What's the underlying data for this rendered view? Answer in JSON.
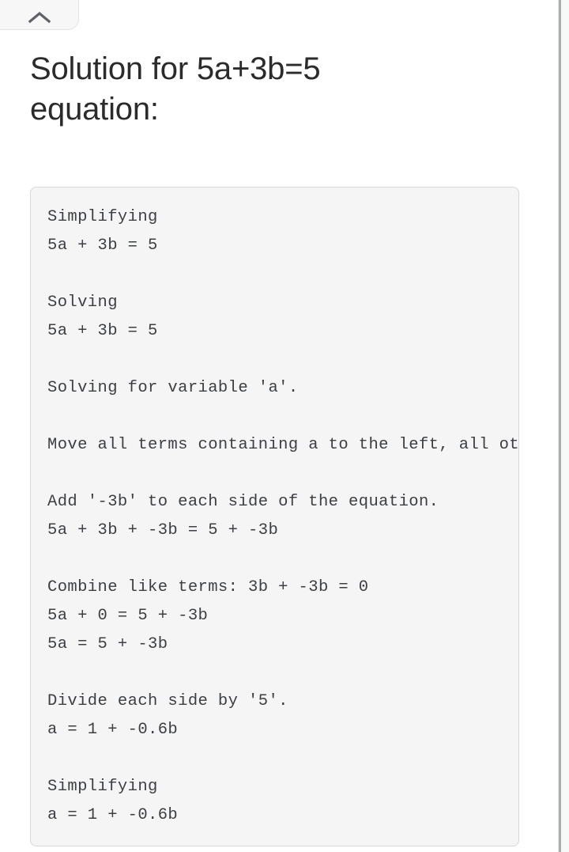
{
  "page": {
    "title": "Solution for 5a+3b=5 equation:"
  },
  "collapse_tab": {
    "icon": "chevron-up-icon",
    "label": ""
  },
  "solution": {
    "lines": [
      "Simplifying",
      "5a + 3b = 5",
      "",
      "Solving",
      "5a + 3b = 5",
      "",
      "Solving for variable 'a'.",
      "",
      "Move all terms containing a to the left, all other terms to the right.",
      "",
      "Add '-3b' to each side of the equation.",
      "5a + 3b + -3b = 5 + -3b",
      "",
      "Combine like terms: 3b + -3b = 0",
      "5a + 0 = 5 + -3b",
      "5a = 5 + -3b",
      "",
      "Divide each side by '5'.",
      "a = 1 + -0.6b",
      "",
      "Simplifying",
      "a = 1 + -0.6b"
    ],
    "text": "Simplifying\n5a + 3b = 5\n\nSolving\n5a + 3b = 5\n\nSolving for variable 'a'.\n\nMove all terms containing a to the left, all other terms to the right.\n\nAdd '-3b' to each side of the equation.\n5a + 3b + -3b = 5 + -3b\n\nCombine like terms: 3b + -3b = 0\n5a + 0 = 5 + -3b\n5a = 5 + -3b\n\nDivide each side by '5'.\na = 1 + -0.6b\n\nSimplifying\na = 1 + -0.6b"
  },
  "colors": {
    "page_background": "#ffffff",
    "title_text": "#2b2b2b",
    "code_background": "#f5f5f5",
    "code_border": "#d8d8d8",
    "code_text": "#3c4043",
    "tab_background": "#f7f7f7",
    "scrollbar_thumb": "#a6aeae"
  },
  "scrollbar": {
    "orientation": "vertical",
    "position": "right"
  }
}
